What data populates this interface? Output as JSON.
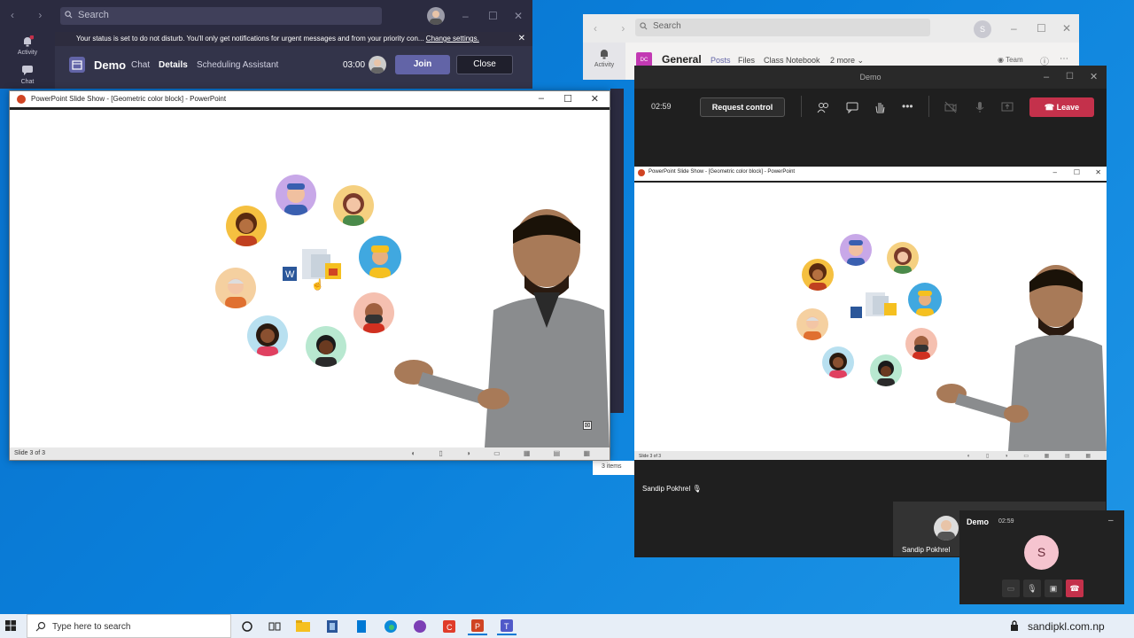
{
  "teams_left": {
    "search_placeholder": "Search",
    "rail": {
      "activity": "Activity",
      "chat": "Chat",
      "activity_badge": "2"
    },
    "banner_text": "Your status is set to do not disturb. You'll only get notifications for urgent messages and from your priority con...",
    "banner_link": "Change settings.",
    "meeting_title": "Demo",
    "tabs": [
      "Chat",
      "Details",
      "Scheduling Assistant"
    ],
    "time": "03:00",
    "join_label": "Join",
    "close_label": "Close"
  },
  "ppt_left": {
    "title": "PowerPoint Slide Show - [Geometric color block] - PowerPoint",
    "status": "Slide 3 of 3"
  },
  "side_count": "3 items",
  "teams_right": {
    "search_placeholder": "Search",
    "avatar_initial": "S",
    "rail": {
      "activity": "Activity"
    },
    "team_badge": "DC",
    "channel": "General",
    "tabs": [
      "Posts",
      "Files",
      "Class Notebook",
      "2 more"
    ],
    "team_label": "Team"
  },
  "meeting": {
    "title": "Demo",
    "timer": "02:59",
    "request_control": "Request control",
    "leave": "Leave"
  },
  "ppt_right": {
    "title": "PowerPoint Slide Show - [Geometric color block] - PowerPoint",
    "status": "Slide 3 of 3"
  },
  "presenter_name": "Sandip Pokhrel",
  "tile_name": "Sandip Pokhrel",
  "mini": {
    "title": "Demo",
    "time": "02:59",
    "initial": "S"
  },
  "taskbar": {
    "search_placeholder": "Type here to search",
    "site": "sandipkl.com.np"
  },
  "colors": {
    "teams_purple": "#6264a7",
    "leave_red": "#c4314b",
    "ppt_orange": "#d04423"
  }
}
